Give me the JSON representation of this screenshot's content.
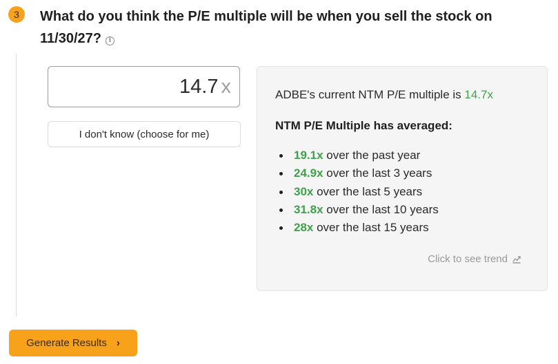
{
  "question": {
    "step_number": "3",
    "text": "What do you think the P/E multiple will be when you sell the stock on 11/30/27?",
    "info_icon": "info-icon"
  },
  "pe_input": {
    "value": "14.7",
    "unit": "x"
  },
  "dont_know_button": {
    "label": "I don't know (choose for me)"
  },
  "info_panel": {
    "current_prefix": "ADBE's current NTM P/E multiple is ",
    "current_value": "14.7x",
    "average_heading": "NTM P/E Multiple has averaged:",
    "averages": [
      {
        "value": "19.1x",
        "label": " over the past year"
      },
      {
        "value": "24.9x",
        "label": " over the last 3 years"
      },
      {
        "value": "30x",
        "label": " over the last 5 years"
      },
      {
        "value": "31.8x",
        "label": " over the last 10 years"
      },
      {
        "value": "28x",
        "label": " over the last 15 years"
      }
    ],
    "trend_link": "Click to see trend",
    "trend_icon": "chart-trend-icon"
  },
  "generate_button": {
    "label": "Generate Results",
    "icon": "chevron-right-icon"
  },
  "colors": {
    "accent_orange": "#f7a21a",
    "highlight_green": "#3fa14a"
  }
}
